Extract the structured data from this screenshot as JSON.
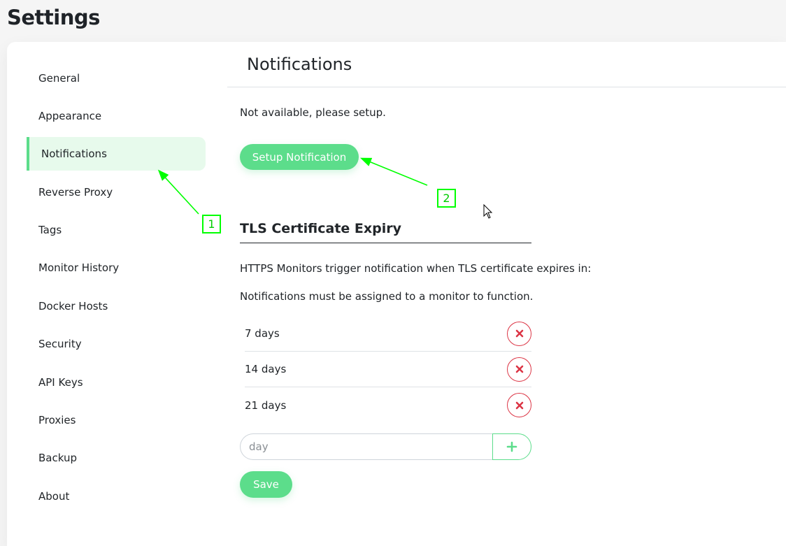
{
  "page": {
    "title": "Settings"
  },
  "sidebar": {
    "items": [
      {
        "label": "General"
      },
      {
        "label": "Appearance"
      },
      {
        "label": "Notifications",
        "active": true
      },
      {
        "label": "Reverse Proxy"
      },
      {
        "label": "Tags"
      },
      {
        "label": "Monitor History"
      },
      {
        "label": "Docker Hosts"
      },
      {
        "label": "Security"
      },
      {
        "label": "API Keys"
      },
      {
        "label": "Proxies"
      },
      {
        "label": "Backup"
      },
      {
        "label": "About"
      }
    ]
  },
  "header": {
    "title": "Notifications"
  },
  "notifications": {
    "status_text": "Not available, please setup.",
    "setup_button_label": "Setup Notification"
  },
  "tls": {
    "title": "TLS Certificate Expiry",
    "description": "HTTPS Monitors trigger notification when TLS certificate expires in:",
    "note": "Notifications must be assigned to a monitor to function.",
    "days": [
      {
        "label": "7 days"
      },
      {
        "label": "14 days"
      },
      {
        "label": "21 days"
      }
    ],
    "day_input_placeholder": "day",
    "save_label": "Save"
  },
  "annotations": [
    {
      "label": "1"
    },
    {
      "label": "2"
    }
  ],
  "colors": {
    "primary": "#5cdd8b",
    "active_bg": "#e7faec",
    "danger": "#dc3545",
    "annotation": "#00ff00"
  }
}
